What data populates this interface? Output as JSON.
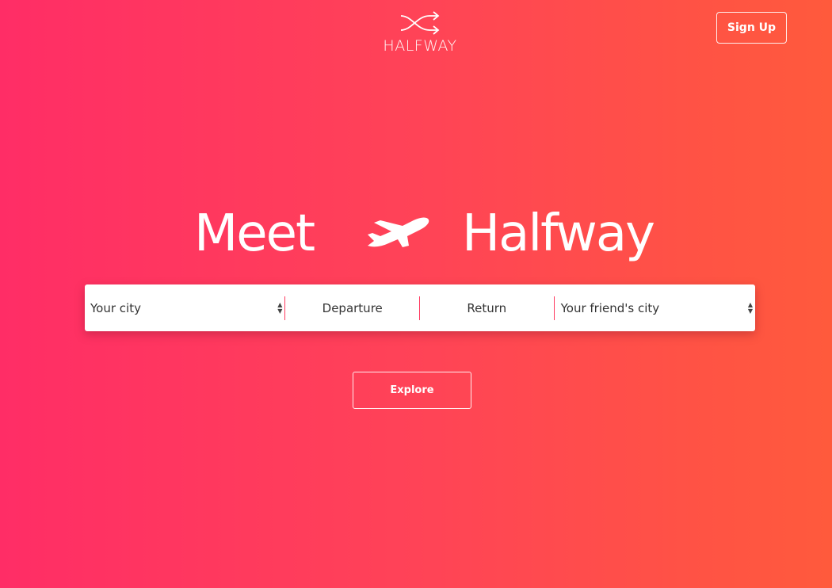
{
  "header": {
    "logo_icon": "shuffle-arrows-icon",
    "logo_text": "HALFWAY",
    "signup_label": "Sign Up"
  },
  "hero": {
    "word_left": "Meet",
    "icon": "airplane-icon",
    "word_right": "Halfway"
  },
  "search": {
    "your_city_placeholder": "Your city",
    "departure_placeholder": "Departure",
    "return_placeholder": "Return",
    "friend_city_placeholder": "Your friend's city"
  },
  "explore_label": "Explore",
  "colors": {
    "gradient_start": "#ff2d66",
    "gradient_end": "#ff5a3c",
    "separator": "#ff3a60"
  }
}
